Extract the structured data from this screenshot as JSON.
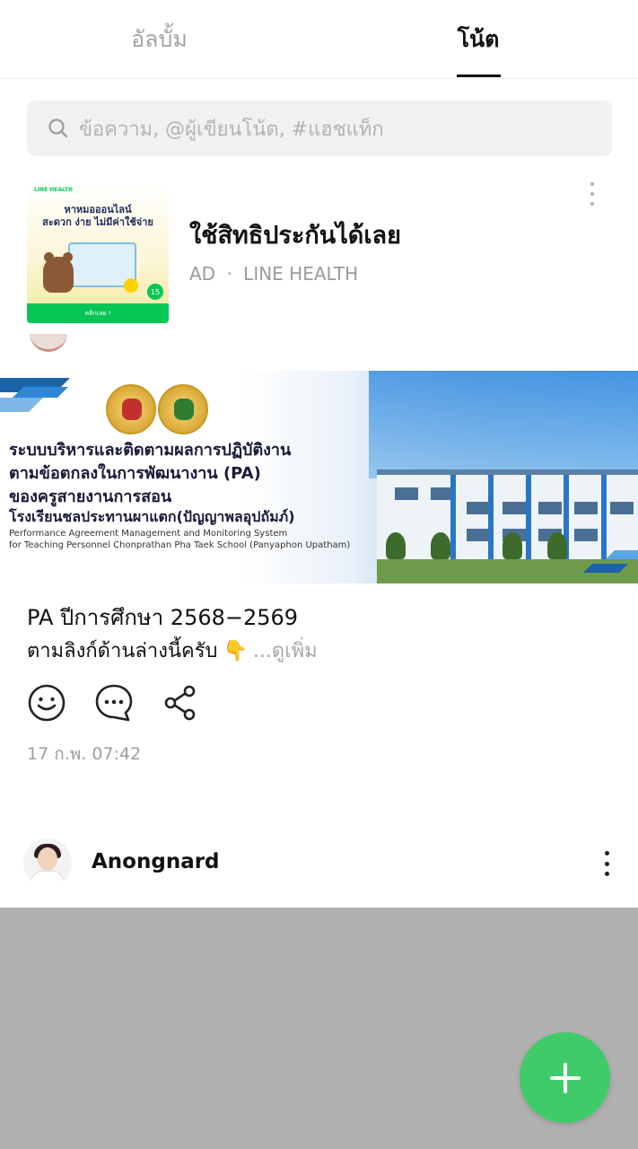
{
  "tabs": [
    {
      "label": "อัลบั้ม",
      "active": false
    },
    {
      "label": "โน้ต",
      "active": true
    }
  ],
  "search": {
    "placeholder": "ข้อความ, @ผู้เขียนโน้ต, #แฮชแท็ก",
    "icon": "search-icon"
  },
  "ad": {
    "title": "ใช้สิทธิประกันได้เลย",
    "label": "AD",
    "separator": "·",
    "sponsor": "LINE HEALTH",
    "thumb": {
      "brand": "LINE HEALTH",
      "headline1": "หาหมอออนไลน์",
      "headline2": "สะดวก ง่าย ไม่มีค่าใช้จ่าย",
      "badge": "15",
      "cta": "คลิกเลย !"
    },
    "more_icon": "more-vertical-icon"
  },
  "banner": {
    "line1": "ระบบบริหารและติดตามผลการปฏิบัติงาน",
    "line2": "ตามข้อตกลงในการพัฒนางาน (PA)",
    "line3": "ของครูสายงานการสอน",
    "line4": "โรงเรียนชลประทานผาแตก(ปัญญาพลอุปถัมภ์)",
    "en1": "Performance Agreement Management and Monitoring System",
    "en2": "for Teaching Personnel Chonprathan Pha Taek School (Panyaphon Upatham)"
  },
  "post": {
    "line1": "PA ปีการศึกษา 2568−2569",
    "line2": "ตามลิงก์ด้านล่างนี้ครับ",
    "emoji": "👇",
    "see_more": "...ดูเพิ่ม",
    "timestamp": "17 ก.พ. 07:42"
  },
  "actions": [
    {
      "name": "react",
      "icon": "smiley-icon"
    },
    {
      "name": "comment",
      "icon": "comment-icon"
    },
    {
      "name": "share",
      "icon": "share-icon"
    }
  ],
  "next_post": {
    "author": "Anongnard",
    "more_icon": "more-vertical-icon"
  },
  "fab": {
    "icon": "plus-icon"
  },
  "colors": {
    "accent": "#3fcb6a",
    "overlay": "#b0b0b0",
    "muted": "#9e9e9e"
  }
}
